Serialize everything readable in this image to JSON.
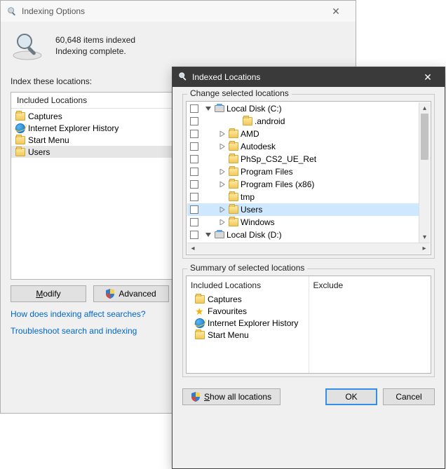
{
  "io": {
    "title": "Indexing Options",
    "items_indexed": "60,648 items indexed",
    "indexing_complete": "Indexing complete.",
    "index_these": "Index these locations:",
    "included_header": "Included Locations",
    "items": [
      {
        "icon": "folder",
        "label": "Captures",
        "selected": false
      },
      {
        "icon": "ie",
        "label": "Internet Explorer History",
        "selected": false
      },
      {
        "icon": "folder",
        "label": "Start Menu",
        "selected": false
      },
      {
        "icon": "folder",
        "label": "Users",
        "selected": true
      }
    ],
    "modify_char": "M",
    "modify_rest": "odify",
    "advanced_label": "Advanced",
    "link1": "How does indexing affect searches?",
    "link2": "Troubleshoot search and indexing"
  },
  "il": {
    "title": "Indexed Locations",
    "change_legend": "Change selected locations",
    "tree": [
      {
        "level": 0,
        "expander": "down",
        "icon": "disk",
        "label": "Local Disk (C:)",
        "selected": false
      },
      {
        "level": 2,
        "expander": "none",
        "icon": "folder",
        "label": ".android",
        "selected": false
      },
      {
        "level": 1,
        "expander": "right",
        "icon": "folder",
        "label": "AMD",
        "selected": false
      },
      {
        "level": 1,
        "expander": "right",
        "icon": "folder",
        "label": "Autodesk",
        "selected": false
      },
      {
        "level": 1,
        "expander": "none",
        "icon": "folder",
        "label": "PhSp_CS2_UE_Ret",
        "selected": false
      },
      {
        "level": 1,
        "expander": "right",
        "icon": "folder",
        "label": "Program Files",
        "selected": false
      },
      {
        "level": 1,
        "expander": "right",
        "icon": "folder",
        "label": "Program Files (x86)",
        "selected": false
      },
      {
        "level": 1,
        "expander": "none",
        "icon": "folder",
        "label": "tmp",
        "selected": false
      },
      {
        "level": 1,
        "expander": "right",
        "icon": "folder",
        "label": "Users",
        "selected": true
      },
      {
        "level": 1,
        "expander": "right",
        "icon": "folder",
        "label": "Windows",
        "selected": false
      },
      {
        "level": 0,
        "expander": "down",
        "icon": "disk",
        "label": "Local Disk (D:)",
        "selected": false
      }
    ],
    "summary_legend": "Summary of selected locations",
    "included_header": "Included Locations",
    "exclude_header": "Exclude",
    "included": [
      {
        "icon": "folder",
        "label": "Captures"
      },
      {
        "icon": "star",
        "label": "Favourites"
      },
      {
        "icon": "ie",
        "label": "Internet Explorer History"
      },
      {
        "icon": "folder",
        "label": "Start Menu"
      }
    ],
    "show_all_char": "S",
    "show_all_rest": "how all locations",
    "ok": "OK",
    "cancel": "Cancel"
  }
}
